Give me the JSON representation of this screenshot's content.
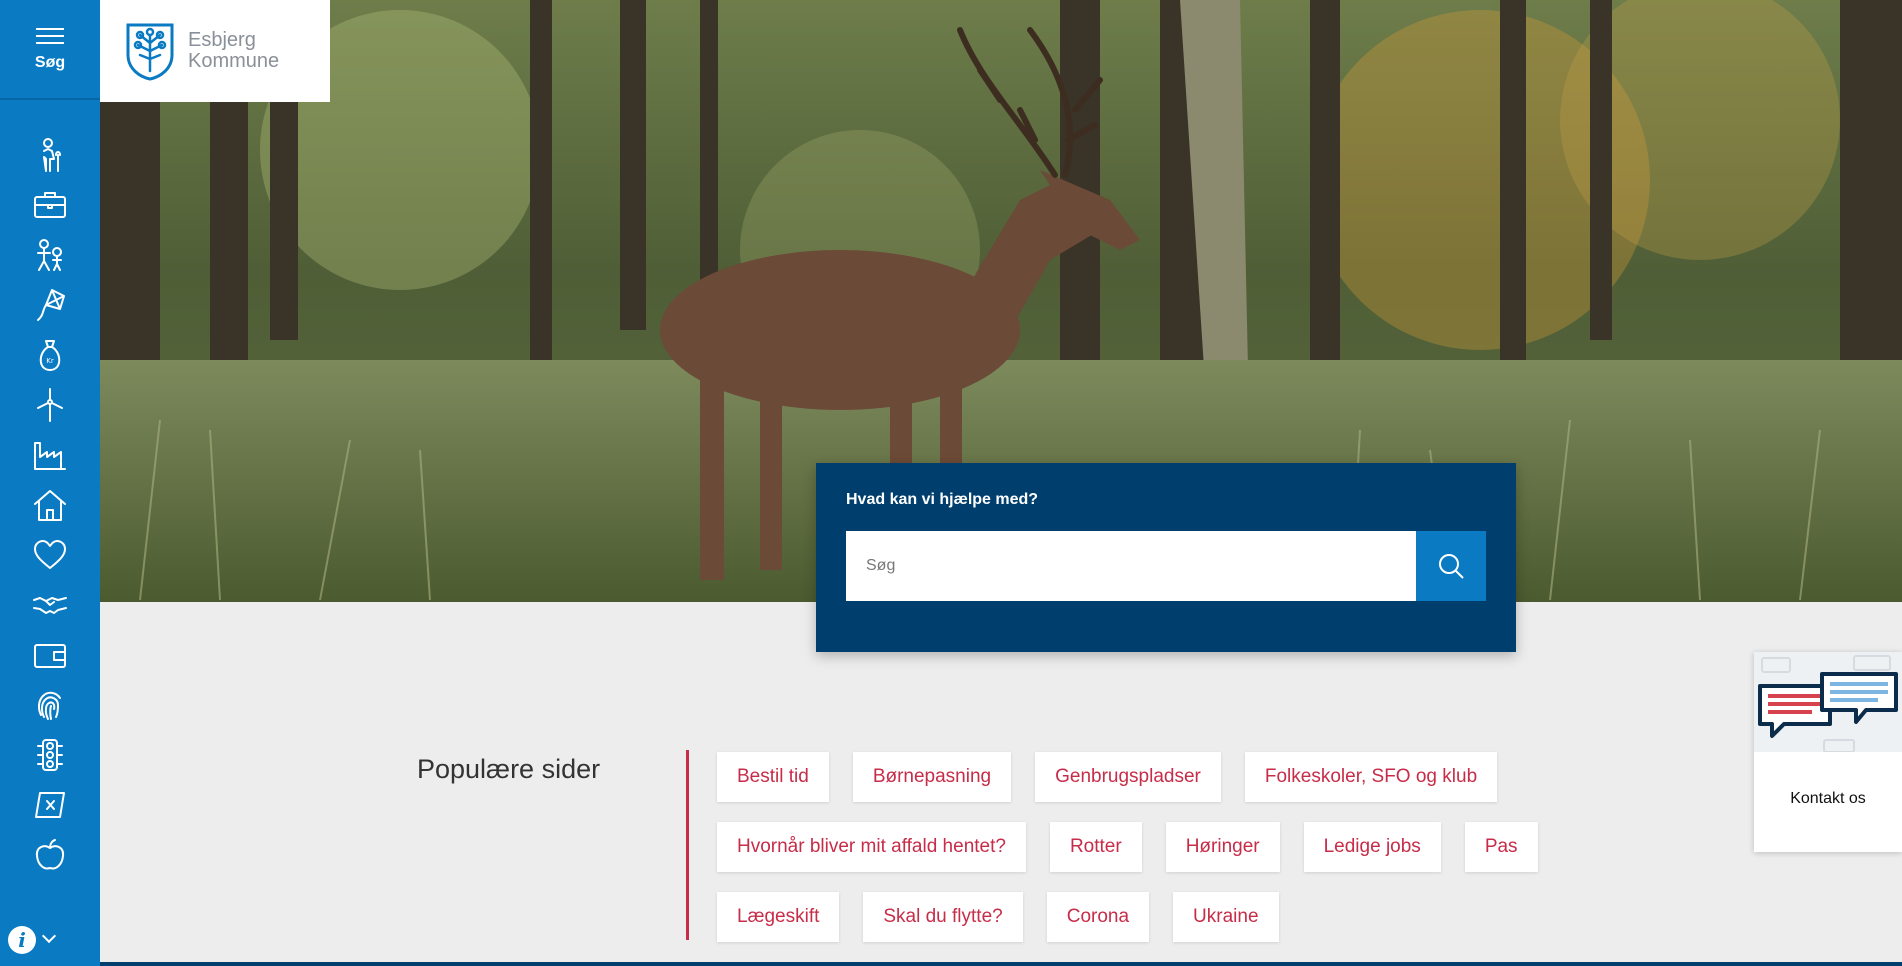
{
  "sidebar": {
    "menu_label": "Søg",
    "icons": [
      "person-cane-icon",
      "briefcase-icon",
      "family-icon",
      "kite-icon",
      "money-bag-icon",
      "wind-turbine-icon",
      "factory-icon",
      "house-icon",
      "heart-icon",
      "handshake-icon",
      "wallet-icon",
      "fingerprint-icon",
      "traffic-light-icon",
      "ballot-icon",
      "apple-icon"
    ],
    "info_label": "i"
  },
  "logo": {
    "line1": "Esbjerg",
    "line2": "Kommune"
  },
  "search": {
    "title": "Hvad kan vi hjælpe med?",
    "placeholder": "Søg"
  },
  "popular": {
    "title": "Populære sider",
    "items": [
      "Bestil tid",
      "Børnepasning",
      "Genbrugspladser",
      "Folkeskoler, SFO og klub",
      "Hvornår bliver mit affald hentet?",
      "Rotter",
      "Høringer",
      "Ledige jobs",
      "Pas",
      "Lægeskift",
      "Skal du flytte?",
      "Corona",
      "Ukraine"
    ]
  },
  "contact": {
    "label": "Kontakt os"
  },
  "colors": {
    "sidebar": "#0a7bc2",
    "search_panel": "#003e6e",
    "accent": "#c72c48",
    "background": "#ededed"
  }
}
